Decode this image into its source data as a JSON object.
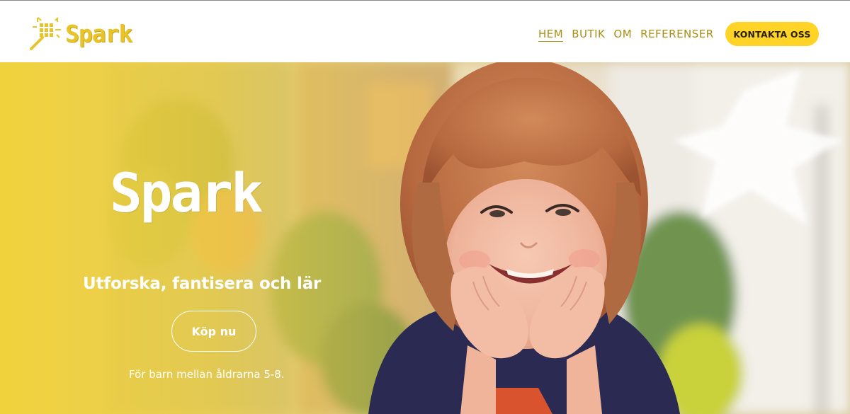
{
  "header": {
    "logo_text": "Spark",
    "logo_icon": "magic-wand-icon",
    "nav": [
      {
        "label": "HEM",
        "active": true
      },
      {
        "label": "BUTIK",
        "active": false
      },
      {
        "label": "OM",
        "active": false
      },
      {
        "label": "REFERENSER",
        "active": false
      }
    ],
    "cta_label": "KONTAKTA OSS"
  },
  "hero": {
    "title": "Spark",
    "tagline": "Utforska, fantisera och lär",
    "button_label": "Köp nu",
    "subtext": "För barn mellan åldrarna 5-8."
  },
  "colors": {
    "brand_yellow": "#ffd426",
    "nav_text": "#a98e15",
    "logo_yellow": "#e8c42a",
    "hero_text": "#ffffff"
  }
}
